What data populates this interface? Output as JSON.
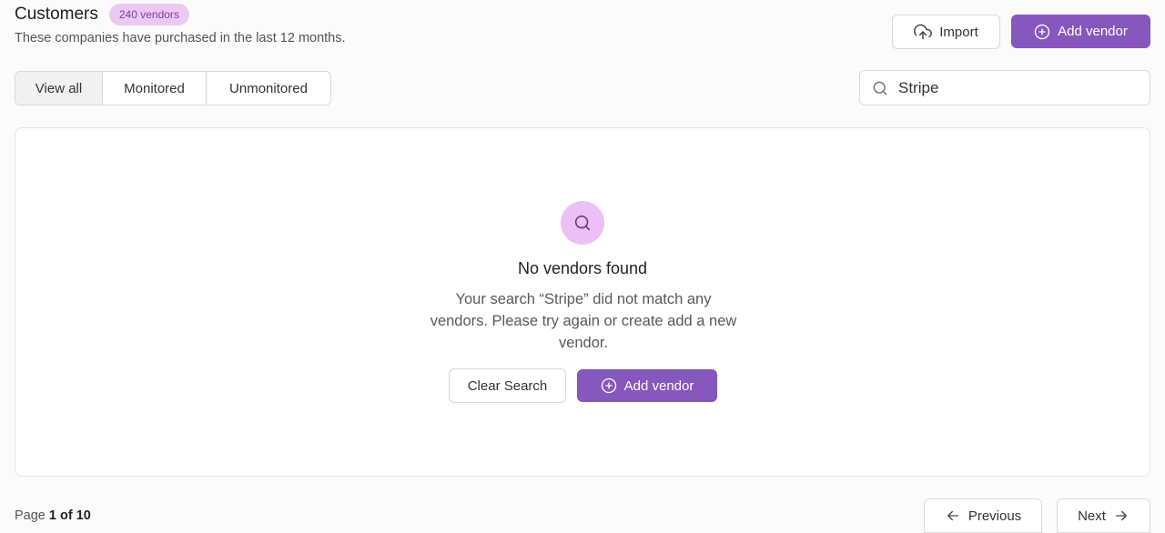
{
  "header": {
    "title": "Customers",
    "badge": "240 vendors",
    "subtitle": "These companies have purchased in the last 12 months.",
    "import_label": "Import",
    "add_vendor_label": "Add vendor"
  },
  "tabs": [
    {
      "label": "View all",
      "active": true
    },
    {
      "label": "Monitored",
      "active": false
    },
    {
      "label": "Unmonitored",
      "active": false
    }
  ],
  "search": {
    "value": "Stripe",
    "icon": "search-icon"
  },
  "empty_state": {
    "icon": "search-icon",
    "title": "No vendors found",
    "description": "Your search “Stripe” did not match any vendors. Please try again or create add a new vendor.",
    "clear_label": "Clear Search",
    "add_label": "Add vendor"
  },
  "pagination": {
    "prefix": "Page",
    "current": "1 of 10",
    "previous_label": "Previous",
    "next_label": "Next"
  },
  "colors": {
    "accent": "#8657bd",
    "badge_bg": "#ecc8f5",
    "icon_circle": "#ecc0f6"
  }
}
